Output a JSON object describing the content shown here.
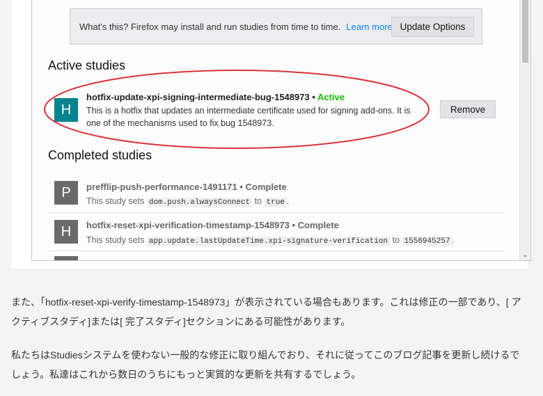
{
  "notice": {
    "text": "What's this? Firefox may install and run studies from time to time.",
    "learn_more": "Learn more",
    "update_button": "Update Options"
  },
  "active": {
    "heading": "Active studies",
    "studies": [
      {
        "icon_letter": "H",
        "name": "hotfix-update-xpi-signing-intermediate-bug-1548973",
        "separator": " • ",
        "status": "Active",
        "description": "This is a hotfix that updates an intermediate certificate used for signing add-ons. It is one of the mechanisms used to fix bug 1548973.",
        "remove_button": "Remove"
      }
    ]
  },
  "completed": {
    "heading": "Completed studies",
    "studies": [
      {
        "icon_letter": "P",
        "name": "prefflip-push-performance-1491171",
        "separator": " • ",
        "status": "Complete",
        "desc_prefix": "This study sets",
        "pref": "dom.push.alwaysConnect",
        "to": "to",
        "value": "true",
        "end": "."
      },
      {
        "icon_letter": "H",
        "name": "hotfix-reset-xpi-verification-timestamp-1548973",
        "separator": " • ",
        "status": "Complete",
        "desc_prefix": "This study sets",
        "pref": "app.update.lastUpdateTime.xpi-signature-verification",
        "to": "to",
        "value": "1556945257",
        "end": "."
      }
    ]
  },
  "colors": {
    "active_status": "#12bc00",
    "link": "#0a84ff",
    "icon_teal": "#00838f",
    "icon_gray": "#6a6a6a",
    "highlight_ellipse": "#d9313a"
  },
  "article": {
    "paragraph1": "また、「hotfix-reset-xpi-verify-timestamp-1548973」が表示されている場合もあります。これは修正の一部であり、[ アクティブスタディ]または[ 完了スタディ]セクションにある可能性があります。",
    "paragraph2": "私たちはStudiesシステムを使わない一般的な修正に取り組んでおり、それに従ってこのブログ記事を更新し続けるでしょう。私達はこれから数日のうちにもっと実質的な更新を共有するでしょう。"
  }
}
